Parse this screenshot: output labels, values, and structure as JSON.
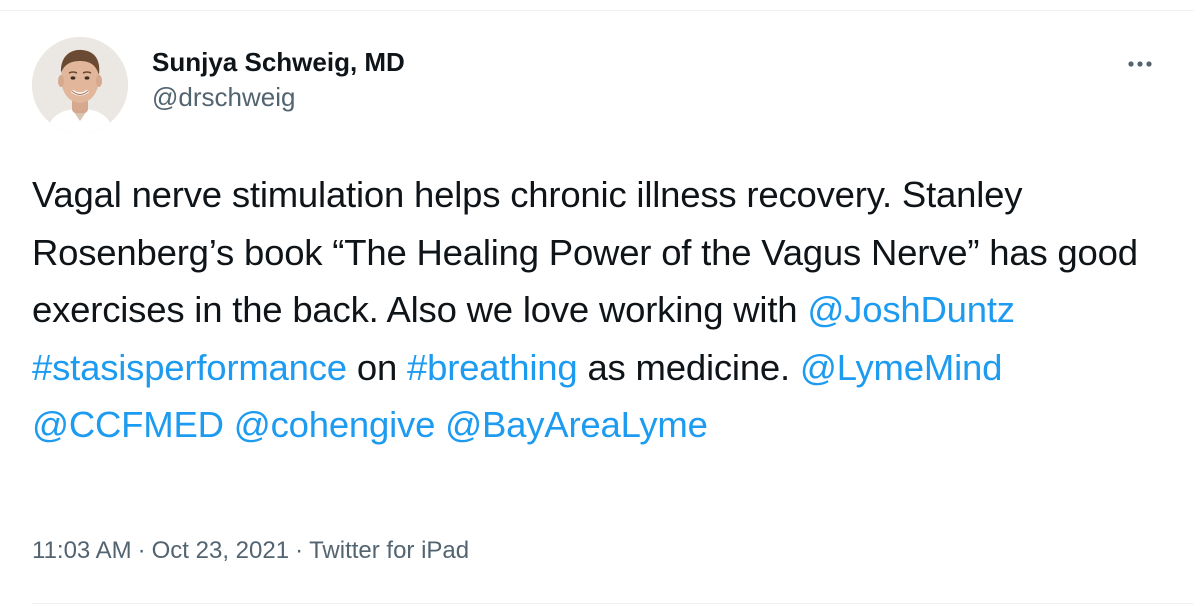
{
  "author": {
    "display_name": "Sunjya Schweig, MD",
    "handle": "@drschweig"
  },
  "menu": {
    "more_icon": "more-horizontal-icon"
  },
  "tweet": {
    "segments": [
      {
        "text": "Vagal nerve stimulation helps chronic illness recovery. Stanley Rosenberg’s book “The Healing Power of the Vagus Nerve” has good exercises in the back. Also we love working with ",
        "link": false
      },
      {
        "text": "@JoshDuntz",
        "link": true,
        "kind": "mention"
      },
      {
        "text": " ",
        "link": false
      },
      {
        "text": "#stasisperformance",
        "link": true,
        "kind": "hashtag"
      },
      {
        "text": " on ",
        "link": false
      },
      {
        "text": "#breathing",
        "link": true,
        "kind": "hashtag"
      },
      {
        "text": " as medicine. ",
        "link": false
      },
      {
        "text": "@LymeMind",
        "link": true,
        "kind": "mention"
      },
      {
        "text": " ",
        "link": false
      },
      {
        "text": "@CCFMED",
        "link": true,
        "kind": "mention"
      },
      {
        "text": " ",
        "link": false
      },
      {
        "text": "@cohengive",
        "link": true,
        "kind": "mention"
      },
      {
        "text": " ",
        "link": false
      },
      {
        "text": "@BayAreaLyme",
        "link": true,
        "kind": "mention"
      }
    ]
  },
  "meta": {
    "time": "11:03 AM",
    "separator": "·",
    "date": "Oct 23, 2021",
    "source": "Twitter for iPad"
  },
  "colors": {
    "text": "#0f1419",
    "secondary": "#536471",
    "link": "#1d9bf0",
    "divider": "#eff3f4"
  }
}
